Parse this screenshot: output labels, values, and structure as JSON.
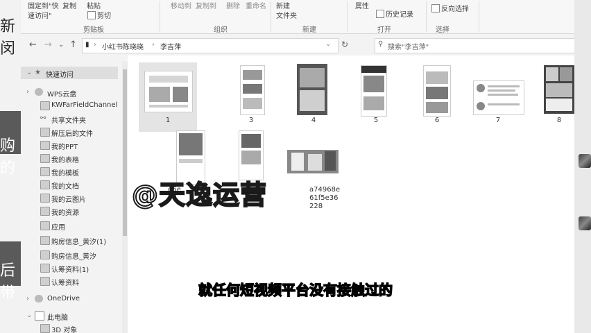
{
  "left_slide": {
    "chars": [
      "新闵",
      "购的",
      "后带"
    ]
  },
  "ribbon": {
    "pin_quick_access": "固定到\"快",
    "quick_access_line2": "速访问\"",
    "copy": "复制",
    "paste": "粘贴",
    "cut": "剪切",
    "clipboard_group": "剪贴板",
    "move_to": "移动到",
    "copy_to": "复制到",
    "delete": "删除",
    "rename": "重命名",
    "organize_group": "组织",
    "new_folder_line1": "新建",
    "new_folder_line2": "文件夹",
    "new_group": "新建",
    "properties": "属性",
    "history": "历史记录",
    "open_group": "打开",
    "invert_selection": "反向选择",
    "select_group": "选择"
  },
  "address": {
    "back": "←",
    "forward": "→",
    "recent": "⌄",
    "up": "↑",
    "path": [
      "小红书陈晓晓",
      "李吉萍"
    ],
    "refresh": "↻",
    "search_placeholder": "搜索\"李吉萍\""
  },
  "sidebar": {
    "items": [
      {
        "label": "快速访问",
        "icon": "star-icon"
      },
      {
        "label": "WPS云盘",
        "icon": "cloud-icon"
      },
      {
        "label": "KWFarFieldChannel",
        "icon": "folder-icon"
      },
      {
        "label": "共享文件夹",
        "icon": "share-icon"
      },
      {
        "label": "解压后的文件",
        "icon": "folder-icon"
      },
      {
        "label": "我的PPT",
        "icon": "folder-icon"
      },
      {
        "label": "我的表格",
        "icon": "folder-icon"
      },
      {
        "label": "我的模板",
        "icon": "folder-icon"
      },
      {
        "label": "我的文档",
        "icon": "folder-icon"
      },
      {
        "label": "我的云图片",
        "icon": "folder-icon"
      },
      {
        "label": "我的资源",
        "icon": "folder-icon"
      },
      {
        "label": "应用",
        "icon": "folder-icon"
      },
      {
        "label": "购房信息_黄汐(1)",
        "icon": "folder-icon"
      },
      {
        "label": "购房信息_黄汐",
        "icon": "folder-icon"
      },
      {
        "label": "认筹资料(1)",
        "icon": "folder-icon"
      },
      {
        "label": "认筹资料",
        "icon": "folder-icon"
      },
      {
        "label": "OneDrive",
        "icon": "onedrive-icon"
      },
      {
        "label": "此电脑",
        "icon": "computer-icon"
      },
      {
        "label": "3D 对象",
        "icon": "cube-icon"
      }
    ]
  },
  "files": [
    {
      "name": "1"
    },
    {
      "name": "3"
    },
    {
      "name": "4"
    },
    {
      "name": "5"
    },
    {
      "name": "6"
    },
    {
      "name": "7"
    },
    {
      "name": "8"
    },
    {
      "name": ""
    },
    {
      "name": ""
    },
    {
      "name": ""
    }
  ],
  "partial_filename": {
    "left_line1": "d6e",
    "left_line2": "5d",
    "right_line1": "a74968e",
    "right_line2": "61f5e36",
    "right_line3": "228"
  },
  "watermark": "@天逸运营",
  "subtitle": "就任何短视频平台没有接触过的"
}
